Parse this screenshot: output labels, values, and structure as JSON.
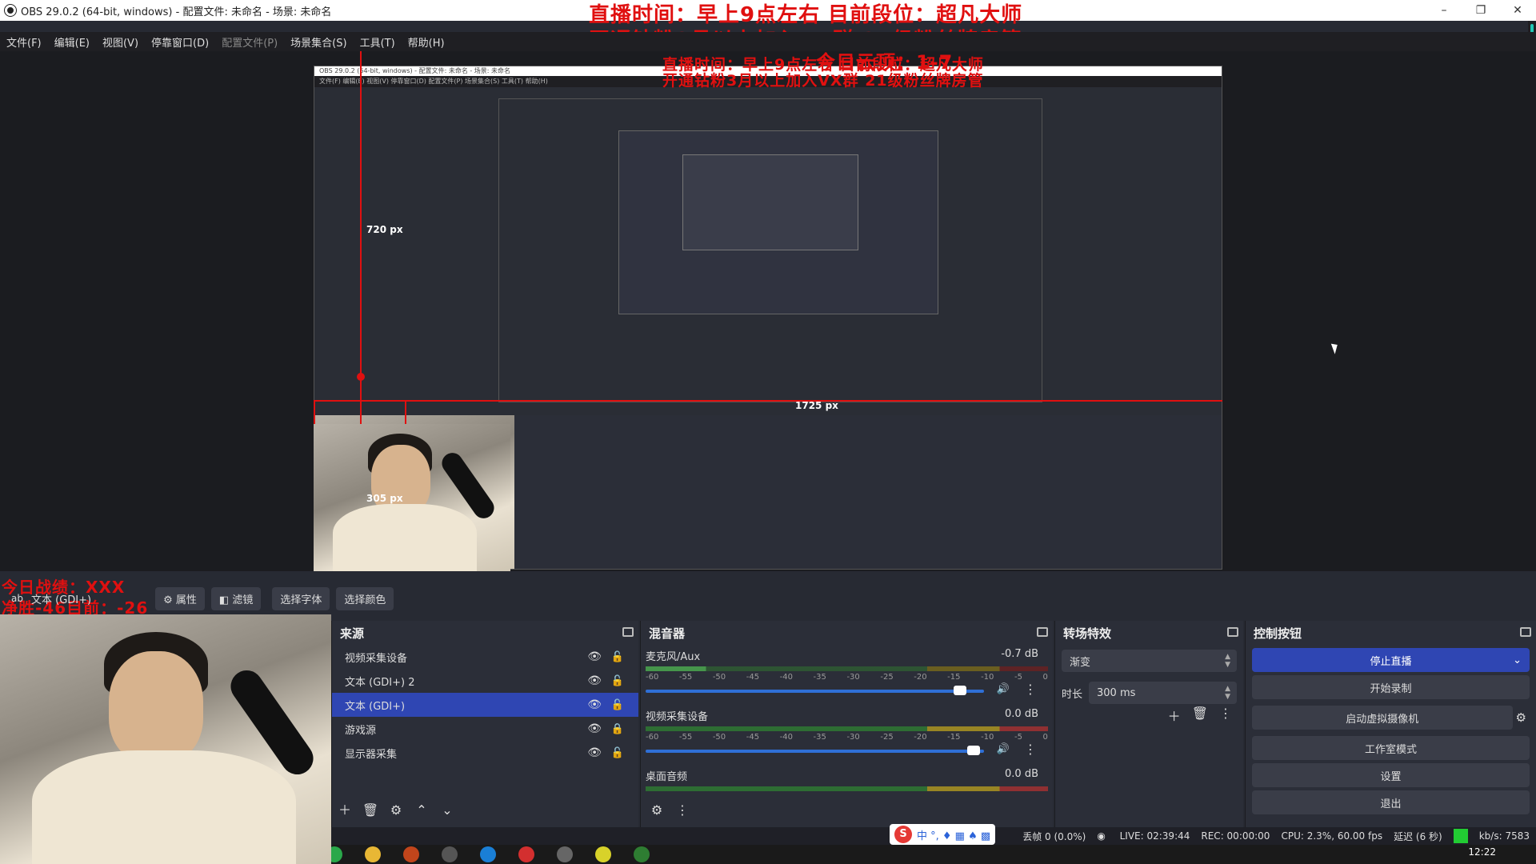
{
  "window": {
    "title": "OBS 29.0.2 (64-bit, windows) - 配置文件: 未命名 - 场景: 未命名",
    "controls": [
      "–",
      "❐",
      "✕"
    ]
  },
  "menu": [
    {
      "label": "文件(F)",
      "enabled": true
    },
    {
      "label": "编辑(E)",
      "enabled": true
    },
    {
      "label": "视图(V)",
      "enabled": true
    },
    {
      "label": "停靠窗口(D)",
      "enabled": true
    },
    {
      "label": "配置文件(P)",
      "enabled": false
    },
    {
      "label": "场景集合(S)",
      "enabled": true
    },
    {
      "label": "工具(T)",
      "enabled": true
    },
    {
      "label": "帮助(H)",
      "enabled": true
    }
  ],
  "overlay": {
    "line1": "直播时间：早上9点左右 目前段位：超凡大师",
    "line2": "开通钻粉3月以上加入VX群 21级粉丝牌房管",
    "line3": "今日云顶：1-7",
    "stats1": "今日战绩：XXX",
    "stats2": "净胜-46目前：-26"
  },
  "preview_labels": {
    "height_px": "720 px",
    "width_px": "1725 px",
    "src_height_px": "305 px"
  },
  "source_toolbar": {
    "source_name": "文本 (GDI+)",
    "properties": "属性",
    "filters": "滤镜",
    "select_font": "选择字体",
    "select_color": "选择颜色"
  },
  "sources": {
    "title": "来源",
    "items": [
      {
        "label": "视频采集设备",
        "selected": false,
        "locked": false
      },
      {
        "label": "文本 (GDI+) 2",
        "selected": false,
        "locked": false
      },
      {
        "label": "文本 (GDI+)",
        "selected": true,
        "locked": false
      },
      {
        "label": "游戏源",
        "selected": false,
        "locked": true
      },
      {
        "label": "显示器采集",
        "selected": false,
        "locked": false
      }
    ]
  },
  "mixer": {
    "title": "混音器",
    "tick_labels": [
      "-60",
      "-55",
      "-50",
      "-45",
      "-40",
      "-35",
      "-30",
      "-25",
      "-20",
      "-15",
      "-10",
      "-5",
      "0"
    ],
    "channels": [
      {
        "name": "麦克风/Aux",
        "db": "-0.7 dB",
        "volume": 0.93
      },
      {
        "name": "视频采集设备",
        "db": "0.0 dB",
        "volume": 0.97
      },
      {
        "name": "桌面音频",
        "db": "0.0 dB",
        "volume": 0.97
      }
    ]
  },
  "transitions": {
    "title": "转场特效",
    "type": "渐变",
    "duration_label": "时长",
    "duration": "300 ms"
  },
  "controls": {
    "title": "控制按钮",
    "stop_stream": "停止直播",
    "start_record": "开始录制",
    "virtual_cam": "启动虚拟摄像机",
    "studio_mode": "工作室模式",
    "settings": "设置",
    "exit": "退出"
  },
  "status": {
    "dropped": "丢帧 0 (0.0%)",
    "live": "LIVE: 02:39:44",
    "rec": "REC: 00:00:00",
    "cpu": "CPU: 2.3%, 60.00 fps",
    "delay": "延迟 (6 秒)",
    "kbps": "kb/s: 7583"
  },
  "ime": {
    "text": "中 °, ♦ ▦ ♠ ▩"
  },
  "clock": "12:22",
  "colors": {
    "accent": "#2f46b3",
    "overlay_red": "#e01010",
    "live_green": "#22cc33"
  }
}
